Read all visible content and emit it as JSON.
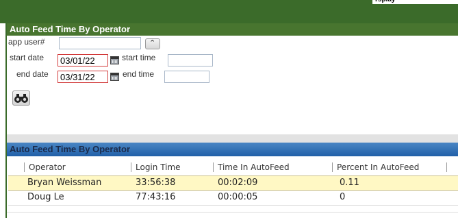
{
  "topbar": {
    "corner_text": "rsplay"
  },
  "form": {
    "header": "Auto Feed Time By Operator",
    "app_user_label": "app user#",
    "app_user_value": "",
    "start_date_label": "start date",
    "start_date_value": "03/01/22",
    "start_time_label": "start time",
    "start_time_value": "",
    "end_date_label": "end date",
    "end_date_value": "03/31/22",
    "end_time_label": "end time",
    "end_time_value": ""
  },
  "grid": {
    "header": "Auto Feed Time By Operator",
    "columns": [
      "Operator",
      "Login Time",
      "Time In AutoFeed",
      "Percent In AutoFeed"
    ],
    "rows": [
      {
        "operator": "Bryan Weissman",
        "login_time": "33:56:38",
        "time_in_autofeed": "00:02:09",
        "percent": "0.11"
      },
      {
        "operator": "Doug Le",
        "login_time": "77:43:16",
        "time_in_autofeed": "00:00:05",
        "percent": "0"
      }
    ]
  }
}
